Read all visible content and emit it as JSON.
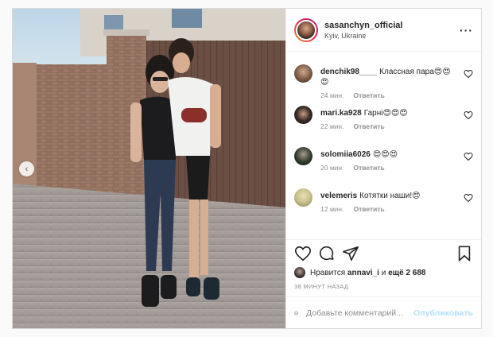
{
  "post": {
    "owner": "sasanchyn_official",
    "location": "Kyiv, Ukraine",
    "more_icon": "more-horizontal-icon"
  },
  "comments": [
    {
      "user": "denchik98____",
      "text": "Классная пара😍😍😍",
      "time": "24 мин.",
      "reply": "Ответить",
      "avatar_color": "#7a5a45"
    },
    {
      "user": "mari.ka928",
      "text": "Гарні😍😍😍",
      "time": "22 мин.",
      "reply": "Ответить",
      "avatar_color": "#1d1a18"
    },
    {
      "user": "solomiia6026",
      "text": "😍😍😍",
      "time": "20 мин.",
      "reply": "Ответить",
      "avatar_color": "#2e3a2a"
    },
    {
      "user": "velemeris",
      "text": "Котятки наши!😍",
      "time": "12 мин.",
      "reply": "Ответить",
      "avatar_color": "#c9c08a"
    }
  ],
  "actions": {
    "icons": [
      "heart-icon",
      "comment-icon",
      "share-icon",
      "bookmark-icon"
    ]
  },
  "likes": {
    "prefix": "Нравится",
    "first_user": "annavi_i",
    "connector": "и",
    "others": "ещё 2 688"
  },
  "time_ago": "38 МИНУТ НАЗАД",
  "add_comment": {
    "placeholder": "Добавьте комментарий...",
    "publish_label": "Опубликовать"
  },
  "colors": {
    "accent_disabled": "#b2dffc",
    "border": "#dbdbdb",
    "muted_text": "#8e8e8e"
  }
}
